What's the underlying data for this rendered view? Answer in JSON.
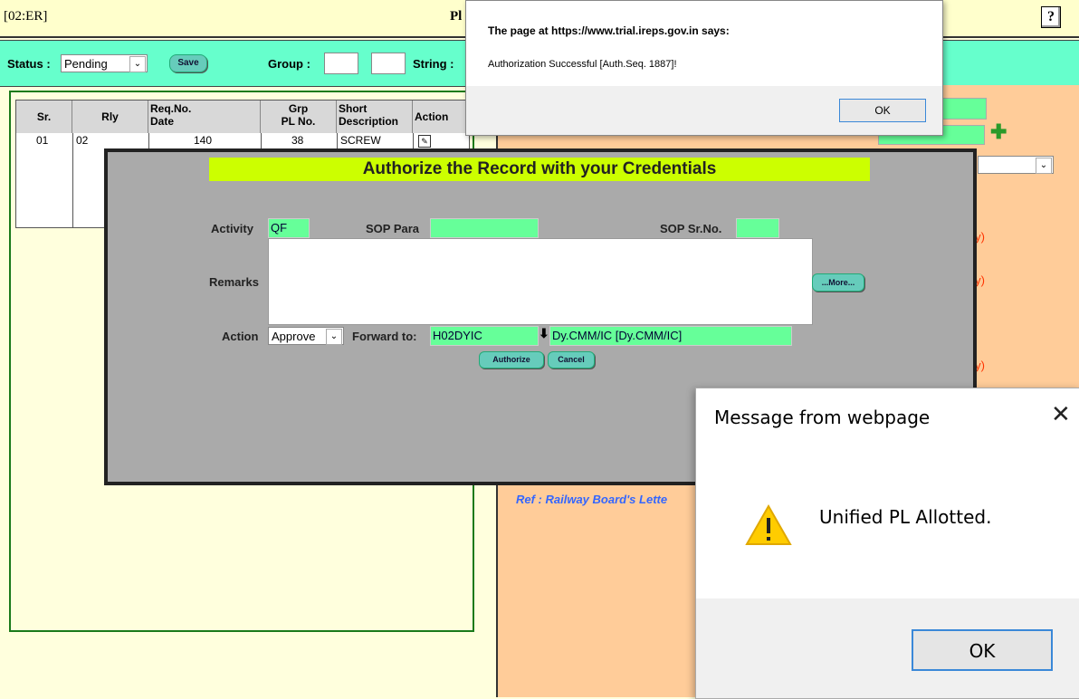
{
  "title_bar": {
    "code": "[02:ER]",
    "title_fragment": "Pl",
    "help_symbol": "?"
  },
  "filter_bar": {
    "status_label": "Status :",
    "status_value": "Pending",
    "save_label": "Save",
    "group_label": "Group :",
    "string_label": "String :"
  },
  "grid": {
    "headers": {
      "sr": "Sr.",
      "rly": "Rly",
      "req": "Req.No.\nDate",
      "grp": "Grp\nPL No.",
      "desc": "Short\nDescription",
      "action": "Action"
    },
    "rows": [
      {
        "sr": "01",
        "rly": "02",
        "req": "140",
        "grp": "38",
        "desc": "SCREW"
      }
    ]
  },
  "right_panel": {
    "note1": "tory)",
    "note2": "tory)",
    "note3": "tory)",
    "ref_text": "Ref : Railway Board's Lette"
  },
  "auth_modal": {
    "title": "Authorize the Record with your Credentials",
    "activity_label": "Activity",
    "activity_value": "QF",
    "sop_para_label": "SOP Para",
    "sop_para_value": "",
    "sop_srno_label": "SOP Sr.No.",
    "sop_srno_value": "",
    "remarks_label": "Remarks",
    "remarks_value": "",
    "more_label": "...More...",
    "action_label": "Action",
    "action_value": "Approve",
    "forward_label": "Forward to:",
    "forward_code": "H02DYIC",
    "forward_name": "Dy.CMM/IC [Dy.CMM/IC]",
    "authorize_label": "Authorize",
    "cancel_label": "Cancel"
  },
  "alert_top": {
    "heading": "The page at https://www.trial.ireps.gov.in says:",
    "message": "Authorization Successful [Auth.Seq. 1887]!",
    "ok_label": "OK"
  },
  "alert_dialog": {
    "heading": "Message from webpage",
    "message": "Unified PL Allotted.",
    "ok_label": "OK",
    "close_symbol": "✕"
  },
  "colors": {
    "filter_bar": "#66ffcc",
    "green_field": "#66ff99",
    "modal_title": "#ccff00",
    "right_panel": "#ffcc99"
  }
}
